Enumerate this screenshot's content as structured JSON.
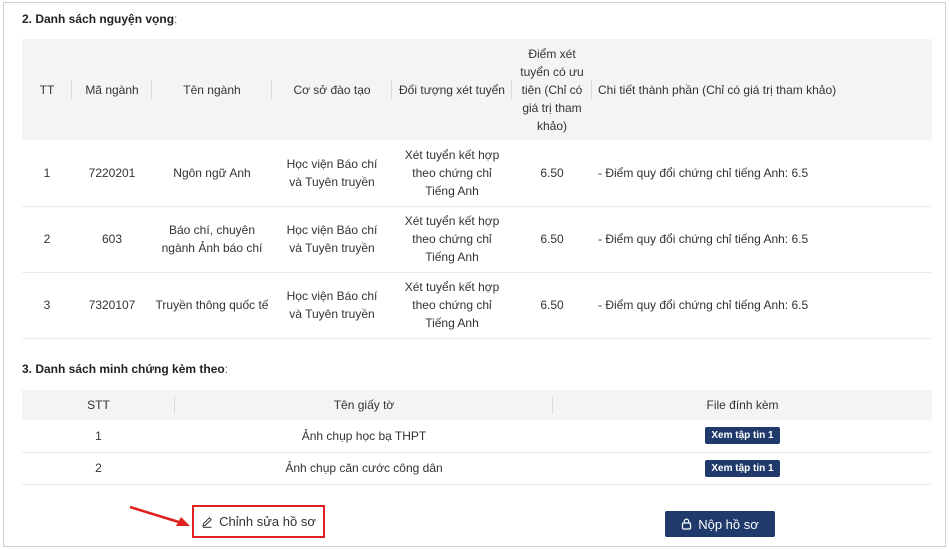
{
  "section2": {
    "title": "2. Danh sách nguyện vọng",
    "colon": ":",
    "headers": [
      "TT",
      "Mã ngành",
      "Tên ngành",
      "Cơ sở đào tạo",
      "Đối tượng xét tuyển",
      "Điểm xét tuyển có ưu tiên (Chỉ có giá trị tham khảo)",
      "Chi tiết thành phần (Chỉ có giá trị tham khảo)"
    ],
    "rows": [
      {
        "tt": "1",
        "ma_nganh": "7220201",
        "ten_nganh": "Ngôn ngữ Anh",
        "co_so": "Học viện Báo chí và Tuyên truyền",
        "doi_tuong": "Xét tuyển kết hợp theo chứng chỉ Tiếng Anh",
        "diem": "6.50",
        "chi_tiet": "- Điểm quy đổi chứng chỉ tiếng Anh: 6.5"
      },
      {
        "tt": "2",
        "ma_nganh": "603",
        "ten_nganh": "Báo chí, chuyên ngành Ảnh báo chí",
        "co_so": "Học viện Báo chí và Tuyên truyền",
        "doi_tuong": "Xét tuyển kết hợp theo chứng chỉ Tiếng Anh",
        "diem": "6.50",
        "chi_tiet": "- Điểm quy đổi chứng chỉ tiếng Anh: 6.5"
      },
      {
        "tt": "3",
        "ma_nganh": "7320107",
        "ten_nganh": "Truyền thông quốc tế",
        "co_so": "Học viện Báo chí và Tuyên truyền",
        "doi_tuong": "Xét tuyển kết hợp theo chứng chỉ Tiếng Anh",
        "diem": "6.50",
        "chi_tiet": "- Điểm quy đổi chứng chỉ tiếng Anh: 6.5"
      }
    ]
  },
  "section3": {
    "title": "3. Danh sách minh chứng kèm theo",
    "colon": ":",
    "headers": [
      "STT",
      "Tên giấy tờ",
      "File đính kèm"
    ],
    "rows": [
      {
        "stt": "1",
        "ten": "Ảnh chụp học bạ THPT",
        "file_label": "Xem tập tin 1"
      },
      {
        "stt": "2",
        "ten": "Ảnh chụp căn cước công dân",
        "file_label": "Xem tập tin 1"
      }
    ]
  },
  "actions": {
    "edit_label": "Chỉnh sửa hồ sơ",
    "edit_icon": "pencil-icon",
    "submit_label": "Nộp hồ sơ",
    "submit_icon": "lock-icon"
  },
  "colors": {
    "primary": "#1f3a6b",
    "highlight": "#e0201f",
    "header_bg": "#f4f4f4"
  }
}
